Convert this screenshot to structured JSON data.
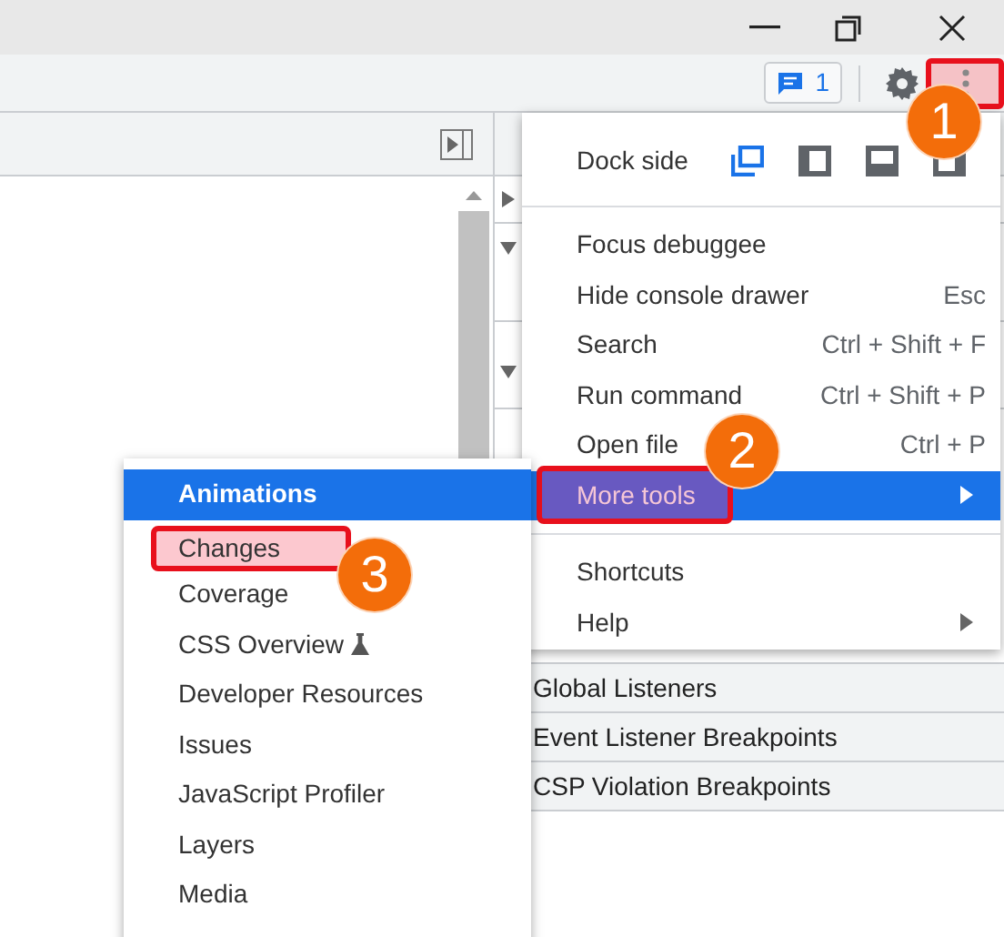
{
  "toolbar": {
    "issues_count": "1",
    "menu_button": {
      "highlighted": true
    }
  },
  "right_panel": {
    "sections": [
      {
        "label": "Global Listeners"
      },
      {
        "label": "Event Listener Breakpoints"
      },
      {
        "label": "CSP Violation Breakpoints"
      }
    ]
  },
  "main_menu": {
    "items": [
      {
        "kind": "dock",
        "label": "Dock side",
        "options": [
          {
            "selected": true
          },
          {
            "selected": false
          },
          {
            "selected": false
          },
          {
            "selected": false
          }
        ]
      },
      {
        "kind": "separator"
      },
      {
        "kind": "item",
        "label": "Focus debuggee",
        "selected": false
      },
      {
        "kind": "item",
        "label": "Hide console drawer",
        "shortcut": "Esc",
        "selected": false
      },
      {
        "kind": "item",
        "label": "Search",
        "shortcut": "Ctrl + Shift + F",
        "selected": false
      },
      {
        "kind": "item",
        "label": "Run command",
        "shortcut": "Ctrl + Shift + P",
        "selected": false
      },
      {
        "kind": "item",
        "label": "Open file",
        "shortcut": "Ctrl + P",
        "selected": false
      },
      {
        "kind": "item",
        "label": "More tools",
        "has_submenu": true,
        "selected": true,
        "highlighted": true
      },
      {
        "kind": "separator"
      },
      {
        "kind": "item",
        "label": "Shortcuts",
        "selected": false
      },
      {
        "kind": "item",
        "label": "Help",
        "has_submenu": true,
        "selected": false
      }
    ]
  },
  "more_tools_menu": {
    "items": [
      {
        "label": "Animations",
        "selected": true,
        "highlighted": false
      },
      {
        "label": "Changes",
        "selected": false,
        "highlighted": true
      },
      {
        "label": "Coverage",
        "selected": false,
        "highlighted": false
      },
      {
        "label": "CSS Overview",
        "selected": false,
        "highlighted": false,
        "experimental": true
      },
      {
        "label": "Developer Resources",
        "selected": false,
        "highlighted": false
      },
      {
        "label": "Issues",
        "selected": false,
        "highlighted": false
      },
      {
        "label": "JavaScript Profiler",
        "selected": false,
        "highlighted": false
      },
      {
        "label": "Layers",
        "selected": false,
        "highlighted": false
      },
      {
        "label": "Media",
        "selected": false,
        "highlighted": false
      }
    ]
  },
  "annotations": [
    {
      "number": "1"
    },
    {
      "number": "2"
    },
    {
      "number": "3"
    }
  ]
}
